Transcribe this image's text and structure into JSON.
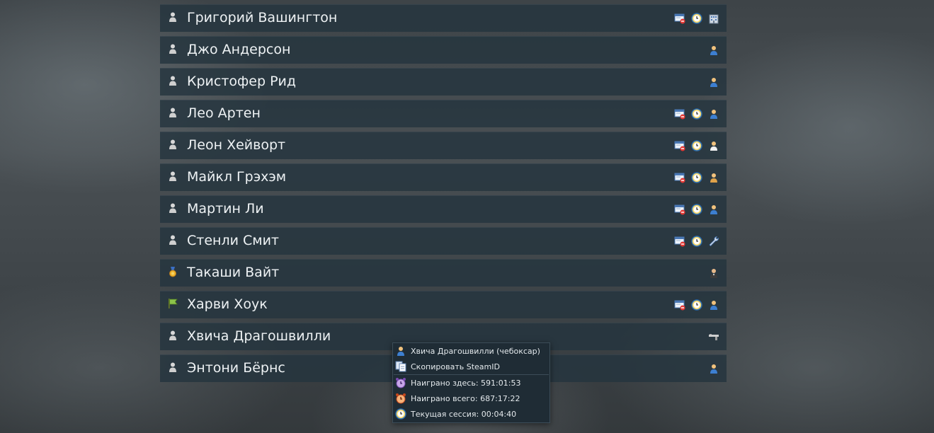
{
  "players": [
    {
      "name": "Григорий Вашингтон",
      "rank_icon": "person-icon",
      "icons": [
        "banned-card-icon",
        "clock-icon",
        "building-icon"
      ]
    },
    {
      "name": "Джо Андерсон",
      "rank_icon": "person-icon",
      "icons": [
        "user-icon"
      ]
    },
    {
      "name": "Кристофер Рид",
      "rank_icon": "person-icon",
      "icons": [
        "user-icon"
      ]
    },
    {
      "name": "Лео Артен",
      "rank_icon": "person-icon",
      "icons": [
        "banned-card-icon",
        "clock-icon",
        "user-icon"
      ]
    },
    {
      "name": "Леон Хейворт",
      "rank_icon": "person-icon",
      "icons": [
        "banned-card-icon",
        "clock-icon",
        "user-white-icon"
      ]
    },
    {
      "name": "Майкл Грэхэм",
      "rank_icon": "person-icon",
      "icons": [
        "banned-card-icon",
        "clock-icon",
        "user-orange-icon"
      ]
    },
    {
      "name": "Мартин Ли",
      "rank_icon": "person-icon",
      "icons": [
        "banned-card-icon",
        "clock-icon",
        "user-icon"
      ]
    },
    {
      "name": "Стенли Смит",
      "rank_icon": "person-icon",
      "icons": [
        "banned-card-icon",
        "clock-icon",
        "wrench-icon"
      ]
    },
    {
      "name": "Такаши Вайт",
      "rank_icon": "medal-icon",
      "icons": [
        "suit-user-icon"
      ]
    },
    {
      "name": "Харви Хоук",
      "rank_icon": "flag-icon",
      "icons": [
        "banned-card-icon",
        "clock-icon",
        "user-icon"
      ]
    },
    {
      "name": "Хвича Драгошвилли",
      "rank_icon": "person-icon",
      "icons": [
        "gun-icon"
      ]
    },
    {
      "name": "Энтони Бёрнс",
      "rank_icon": "person-icon",
      "icons": [
        "user-icon"
      ]
    }
  ],
  "context_menu": {
    "player_name": "Хвича Драгошвилли (чебоксар)",
    "copy_steamid": "Скопировать SteamID",
    "played_here": "Наиграно здесь: 591:01:53",
    "played_total": "Наиграно всего: 687:17:22",
    "current_session": "Текущая сессия: 00:04:40"
  },
  "colors": {
    "row_bg": "#24343e",
    "text": "#eef2f4",
    "menu_bg": "#1f2c35"
  }
}
